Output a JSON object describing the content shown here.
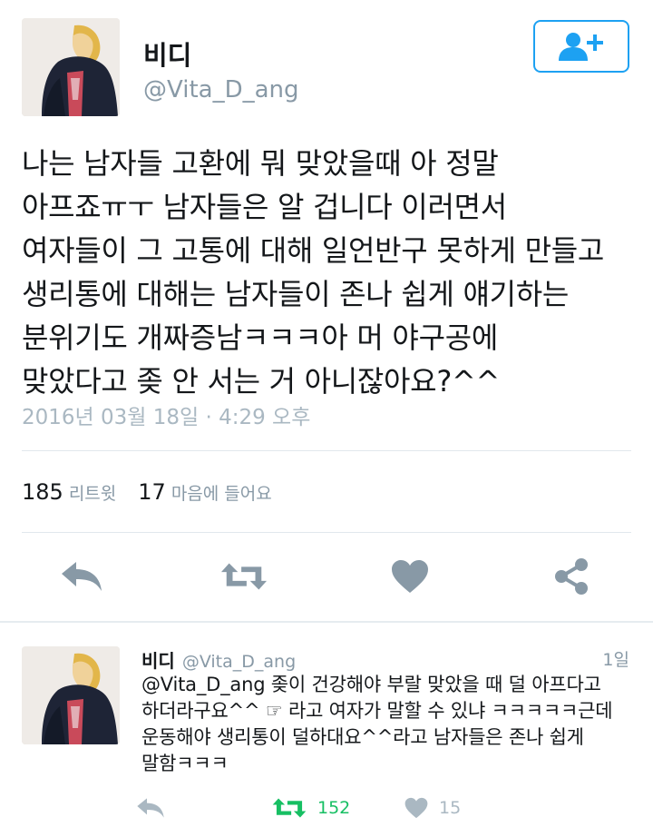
{
  "author": {
    "name": "비디",
    "handle": "@Vita_D_ang"
  },
  "follow_button": {
    "icon": "add-user-icon"
  },
  "tweet": {
    "text": "나는 남자들 고환에 뭐 맞았을때 아 정말\n아프죠ㅠㅜ 남자들은 알 겁니다 이러면서\n여자들이 그 고통에 대해 일언반구 못하게 만들고\n생리통에 대해는 남자들이 존나 쉽게 얘기하는\n분위기도 개짜증남ㅋㅋㅋ아 머 야구공에\n맞았다고 좆 안 서는 거 아니잖아요?^^",
    "timestamp": "2016년 03월 18일 · 4:29 오후"
  },
  "stats": {
    "retweets_count": "185",
    "retweets_label": "리트윗",
    "likes_count": "17",
    "likes_label": "마음에 들어요"
  },
  "actions": [
    "reply-icon",
    "retweet-icon",
    "heart-icon",
    "share-icon"
  ],
  "reply": {
    "name": "비디",
    "handle": "@Vita_D_ang",
    "time": "1일",
    "text": "@Vita_D_ang 좆이 건강해야 부랄 맞았을 때 덜 아프다고\n하더라구요^^ ☞ 라고 여자가 말할 수 있냐 ㅋㅋㅋㅋㅋ근데\n운동해야 생리통이 덜하대요^^라고 남자들은 존나 쉽게\n말함ㅋㅋㅋ",
    "retweets": "152",
    "likes": "15"
  },
  "colors": {
    "accent": "#1da1f2",
    "retweet_green": "#17bf63",
    "icon_gray": "#8899a6",
    "reply_icon_gray": "#aab8c2"
  }
}
